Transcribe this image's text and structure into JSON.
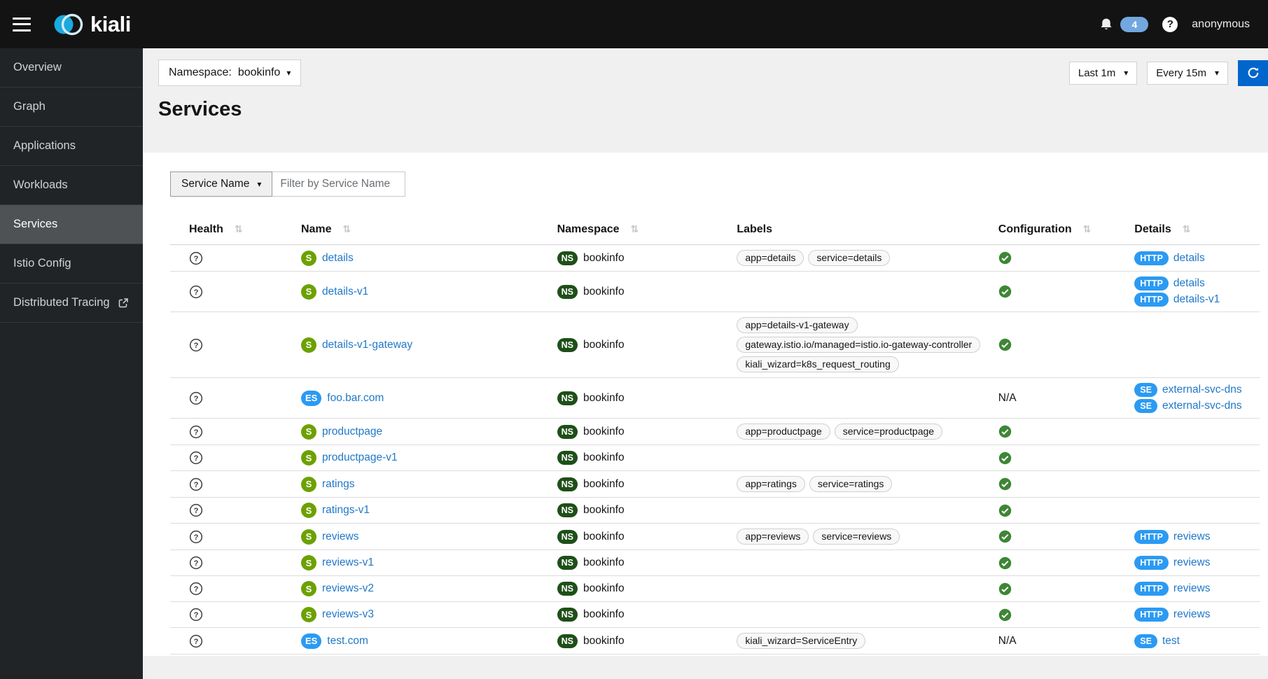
{
  "navbar": {
    "brand": "kiali",
    "notifications_count": "4",
    "user": "anonymous"
  },
  "sidebar": {
    "items": [
      {
        "label": "Overview",
        "active": false
      },
      {
        "label": "Graph",
        "active": false
      },
      {
        "label": "Applications",
        "active": false
      },
      {
        "label": "Workloads",
        "active": false
      },
      {
        "label": "Services",
        "active": true
      },
      {
        "label": "Istio Config",
        "active": false
      },
      {
        "label": "Distributed Tracing",
        "active": false,
        "external": true
      }
    ]
  },
  "toolbar": {
    "namespace_label": "Namespace:",
    "namespace_value": "bookinfo",
    "duration": "Last 1m",
    "refresh_interval": "Every 15m"
  },
  "page": {
    "title": "Services"
  },
  "filter": {
    "field_button": "Service Name",
    "input_placeholder": "Filter by Service Name"
  },
  "icons": {
    "caret_down": "▾",
    "sort": "⇅",
    "help": "?"
  },
  "table": {
    "na_text": "N/A",
    "columns": [
      {
        "label": "Health",
        "sortable": true
      },
      {
        "label": "Name",
        "sortable": true
      },
      {
        "label": "Namespace",
        "sortable": true
      },
      {
        "label": "Labels",
        "sortable": false
      },
      {
        "label": "Configuration",
        "sortable": true
      },
      {
        "label": "Details",
        "sortable": true
      }
    ],
    "rows": [
      {
        "health": "unknown",
        "type_badge": "S",
        "name": "details",
        "namespace": {
          "badge": "NS",
          "name": "bookinfo"
        },
        "labels": [
          "app=details",
          "service=details"
        ],
        "configuration": "ok",
        "details": [
          {
            "badge": "HTTP",
            "text": "details"
          }
        ]
      },
      {
        "health": "unknown",
        "type_badge": "S",
        "name": "details-v1",
        "namespace": {
          "badge": "NS",
          "name": "bookinfo"
        },
        "labels": [],
        "configuration": "ok",
        "details": [
          {
            "badge": "HTTP",
            "text": "details"
          },
          {
            "badge": "HTTP",
            "text": "details-v1"
          }
        ]
      },
      {
        "health": "unknown",
        "type_badge": "S",
        "name": "details-v1-gateway",
        "namespace": {
          "badge": "NS",
          "name": "bookinfo"
        },
        "labels": [
          "app=details-v1-gateway",
          "gateway.istio.io/managed=istio.io-gateway-controller",
          "kiali_wizard=k8s_request_routing"
        ],
        "configuration": "ok",
        "details": []
      },
      {
        "health": "unknown",
        "type_badge": "ES",
        "name": "foo.bar.com",
        "namespace": {
          "badge": "NS",
          "name": "bookinfo"
        },
        "labels": [],
        "configuration": "na",
        "details": [
          {
            "badge": "SE",
            "text": "external-svc-dns"
          },
          {
            "badge": "SE",
            "text": "external-svc-dns"
          }
        ]
      },
      {
        "health": "unknown",
        "type_badge": "S",
        "name": "productpage",
        "namespace": {
          "badge": "NS",
          "name": "bookinfo"
        },
        "labels": [
          "app=productpage",
          "service=productpage"
        ],
        "configuration": "ok",
        "details": []
      },
      {
        "health": "unknown",
        "type_badge": "S",
        "name": "productpage-v1",
        "namespace": {
          "badge": "NS",
          "name": "bookinfo"
        },
        "labels": [],
        "configuration": "ok",
        "details": []
      },
      {
        "health": "unknown",
        "type_badge": "S",
        "name": "ratings",
        "namespace": {
          "badge": "NS",
          "name": "bookinfo"
        },
        "labels": [
          "app=ratings",
          "service=ratings"
        ],
        "configuration": "ok",
        "details": []
      },
      {
        "health": "unknown",
        "type_badge": "S",
        "name": "ratings-v1",
        "namespace": {
          "badge": "NS",
          "name": "bookinfo"
        },
        "labels": [],
        "configuration": "ok",
        "details": []
      },
      {
        "health": "unknown",
        "type_badge": "S",
        "name": "reviews",
        "namespace": {
          "badge": "NS",
          "name": "bookinfo"
        },
        "labels": [
          "app=reviews",
          "service=reviews"
        ],
        "configuration": "ok",
        "details": [
          {
            "badge": "HTTP",
            "text": "reviews"
          }
        ]
      },
      {
        "health": "unknown",
        "type_badge": "S",
        "name": "reviews-v1",
        "namespace": {
          "badge": "NS",
          "name": "bookinfo"
        },
        "labels": [],
        "configuration": "ok",
        "details": [
          {
            "badge": "HTTP",
            "text": "reviews"
          }
        ]
      },
      {
        "health": "unknown",
        "type_badge": "S",
        "name": "reviews-v2",
        "namespace": {
          "badge": "NS",
          "name": "bookinfo"
        },
        "labels": [],
        "configuration": "ok",
        "details": [
          {
            "badge": "HTTP",
            "text": "reviews"
          }
        ]
      },
      {
        "health": "unknown",
        "type_badge": "S",
        "name": "reviews-v3",
        "namespace": {
          "badge": "NS",
          "name": "bookinfo"
        },
        "labels": [],
        "configuration": "ok",
        "details": [
          {
            "badge": "HTTP",
            "text": "reviews"
          }
        ]
      },
      {
        "health": "unknown",
        "type_badge": "ES",
        "name": "test.com",
        "namespace": {
          "badge": "NS",
          "name": "bookinfo"
        },
        "labels": [
          "kiali_wizard=ServiceEntry"
        ],
        "configuration": "na",
        "details": [
          {
            "badge": "SE",
            "text": "test"
          }
        ]
      }
    ]
  },
  "colors": {
    "masthead_bg": "#131313",
    "sidebar_bg": "#212427",
    "sidebar_active_bg": "#4f5255",
    "accent_blue": "#0066cc",
    "link_blue": "#2178c9",
    "badge_blue": "#2b9af3",
    "service_badge_green": "#6ca100",
    "namespace_badge_green": "#1e4f18",
    "health_ok_green": "#3e8635",
    "notification_badge_bg": "#73a7e0"
  }
}
